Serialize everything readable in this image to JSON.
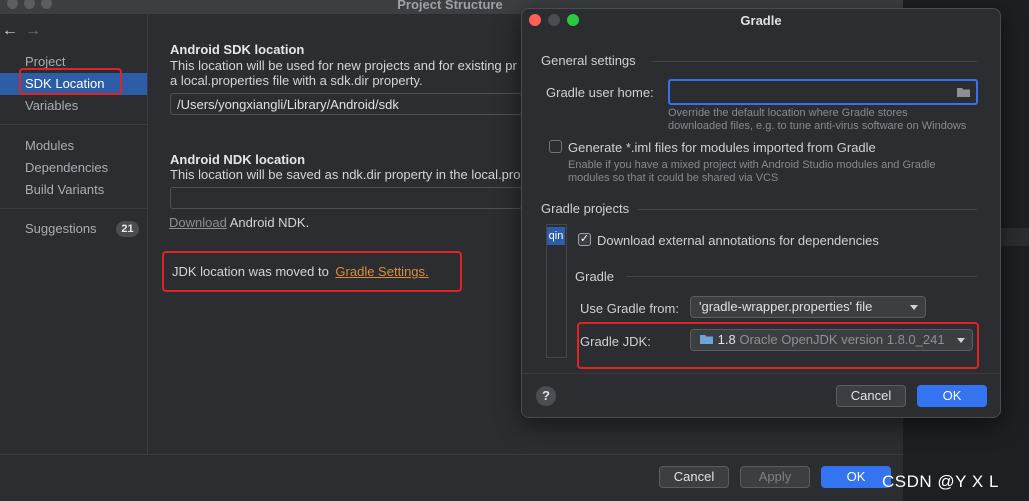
{
  "main_window": {
    "title": "Project Structure",
    "nav_back": "←",
    "nav_forward": "→"
  },
  "sidebar": {
    "items": [
      {
        "label": "Project"
      },
      {
        "label": "SDK Location"
      },
      {
        "label": "Variables"
      },
      {
        "label": "Modules"
      },
      {
        "label": "Dependencies"
      },
      {
        "label": "Build Variants"
      },
      {
        "label": "Suggestions",
        "badge": "21"
      }
    ],
    "selected": "SDK Location"
  },
  "sdk_section": {
    "heading": "Android SDK location",
    "desc_line1": "This location will be used for new projects and for existing pr",
    "desc_line2": "a local.properties file with a sdk.dir property.",
    "path_value": "/Users/yongxiangli/Library/Android/sdk"
  },
  "ndk_section": {
    "heading": "Android NDK location",
    "desc_line1": "This location will be saved as ndk.dir property in the local.pro",
    "path_value": "",
    "download_link": "Download",
    "download_suffix": "Android NDK."
  },
  "jdk_notice": {
    "text": "JDK location was moved to",
    "link": "Gradle Settings."
  },
  "main_buttons": {
    "cancel": "Cancel",
    "apply": "Apply",
    "ok": "OK"
  },
  "gradle_dialog": {
    "title": "Gradle",
    "general_settings": "General settings",
    "user_home_label": "Gradle user home:",
    "user_home_value": "",
    "user_home_hint_1": "Override the default location where Gradle stores",
    "user_home_hint_2": "downloaded files, e.g. to tune anti-virus software on Windows",
    "iml_checkbox_label": "Generate *.iml files for modules imported from Gradle",
    "iml_checked": false,
    "iml_hint_1": "Enable if you have a mixed project with Android Studio modules and Gradle",
    "iml_hint_2": "modules so that it could be shared via VCS",
    "gradle_projects": "Gradle projects",
    "project_tab_label": "qin",
    "annotations_label": "Download external annotations for dependencies",
    "annotations_checked": true,
    "gradle_subsection": "Gradle",
    "use_gradle_from_label": "Use Gradle from:",
    "use_gradle_from_value": "'gradle-wrapper.properties' file",
    "gradle_jdk_label": "Gradle JDK:",
    "gradle_jdk_version": "1.8",
    "gradle_jdk_desc": "Oracle OpenJDK version 1.8.0_241",
    "help": "?",
    "cancel": "Cancel",
    "ok": "OK"
  },
  "watermark": "CSDN @Y    X    L",
  "colors": {
    "accent": "#3574f0",
    "selection": "#2e5da8",
    "highlight_box": "#e02424",
    "link_orange": "#d88e3b"
  }
}
